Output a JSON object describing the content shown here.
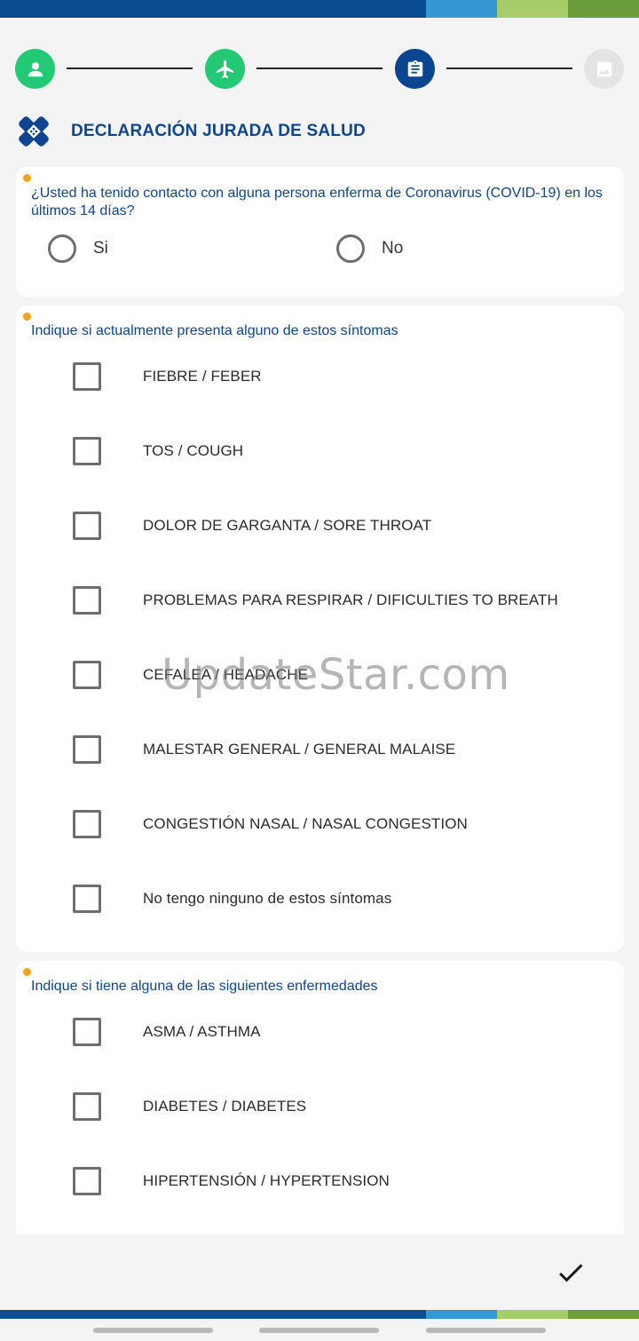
{
  "colors": {
    "brand_blue": "#0a4d92",
    "step_done": "#23c974",
    "step_active": "#0a4591",
    "required_dot": "#f7a21b"
  },
  "stepper": [
    {
      "icon": "person-icon",
      "state": "done"
    },
    {
      "icon": "airplane-icon",
      "state": "done"
    },
    {
      "icon": "clipboard-icon",
      "state": "active"
    },
    {
      "icon": "image-icon",
      "state": "pending"
    }
  ],
  "header": {
    "icon": "bandage-icon",
    "title": "DECLARACIÓN JURADA DE SALUD"
  },
  "q1": {
    "question": "¿Usted ha tenido contacto con alguna persona enferma de Coronavirus (COVID-19) en los últimos 14 días?",
    "options": [
      "Si",
      "No"
    ]
  },
  "q2": {
    "question": "Indique si actualmente presenta alguno de estos síntomas",
    "options": [
      "FIEBRE / FEBER",
      "TOS / COUGH",
      "DOLOR DE GARGANTA / SORE THROAT",
      "PROBLEMAS PARA RESPIRAR / DIFICULTIES TO BREATH",
      "CEFALEA / HEADACHE",
      "MALESTAR GENERAL / GENERAL MALAISE",
      "CONGESTIÓN NASAL / NASAL CONGESTION",
      "No tengo ninguno de estos síntomas"
    ]
  },
  "q3": {
    "question": "Indique si tiene alguna de las siguientes enfermedades",
    "options": [
      "ASMA / ASTHMA",
      "DIABETES / DIABETES",
      "HIPERTENSIÓN / HYPERTENSION"
    ]
  },
  "watermark": "UpdateStar.com",
  "submit": {
    "icon": "checkmark-icon"
  }
}
